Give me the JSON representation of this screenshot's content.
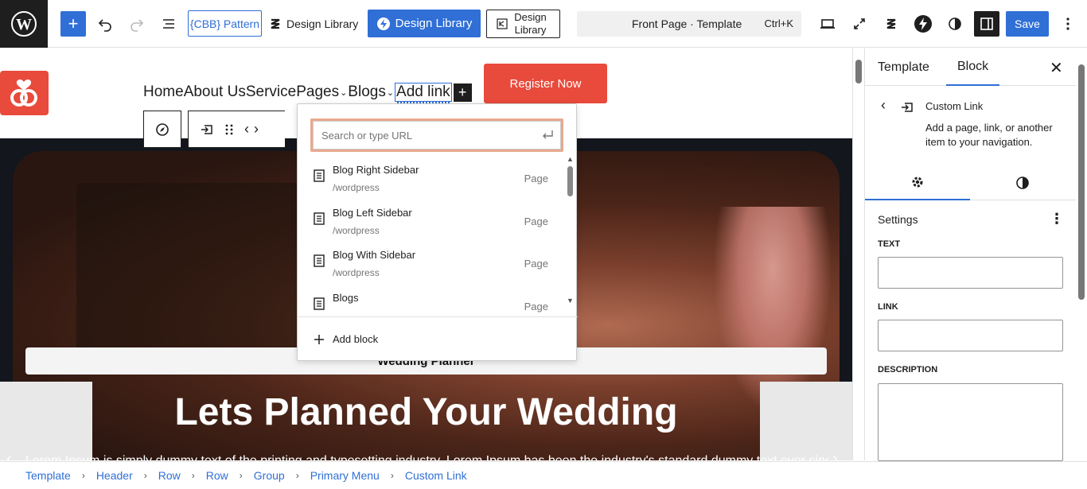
{
  "toolbar": {
    "add_label": "+",
    "cbb_label": "{CBB} Pattern",
    "design_library_1": "Design Library",
    "design_library_2": "Design Library",
    "design_library_3": "Design Library",
    "command_title": "Front Page · Template",
    "command_shortcut": "Ctrl+K",
    "save_label": "Save"
  },
  "site": {
    "nav": [
      "Home",
      "About Us",
      "Service",
      "Pages",
      "Blogs",
      "Add link"
    ],
    "register_label": "Register Now",
    "hero_badge": "Wedding Planner",
    "hero_title": "Lets Planned Your Wedding",
    "hero_text": "Lorem Ipsum is simply dummy text of the printing and typesetting industry. Lorem Ipsum has been the industry's standard dummy text ever since"
  },
  "link_popover": {
    "search_placeholder": "Search or type URL",
    "results": [
      {
        "title": "Blog Right Sidebar",
        "url": "/wordpress",
        "type": "Page"
      },
      {
        "title": "Blog Left Sidebar",
        "url": "/wordpress",
        "type": "Page"
      },
      {
        "title": "Blog With Sidebar",
        "url": "/wordpress",
        "type": "Page"
      },
      {
        "title": "Blogs",
        "url": "",
        "type": "Page"
      }
    ],
    "add_block_label": "Add block"
  },
  "sidebar": {
    "tabs": [
      "Template",
      "Block"
    ],
    "block_name": "Custom Link",
    "block_desc": "Add a page, link, or another item to your navigation.",
    "settings_label": "Settings",
    "text_label": "TEXT",
    "text_value": "",
    "link_label": "LINK",
    "link_value": "",
    "description_label": "DESCRIPTION",
    "description_value": ""
  },
  "breadcrumb": [
    "Template",
    "Header",
    "Row",
    "Row",
    "Group",
    "Primary Menu",
    "Custom Link"
  ],
  "colors": {
    "accent": "#2f6fd6",
    "brand_red": "#e84a3b",
    "dark": "#1e1e1e"
  }
}
